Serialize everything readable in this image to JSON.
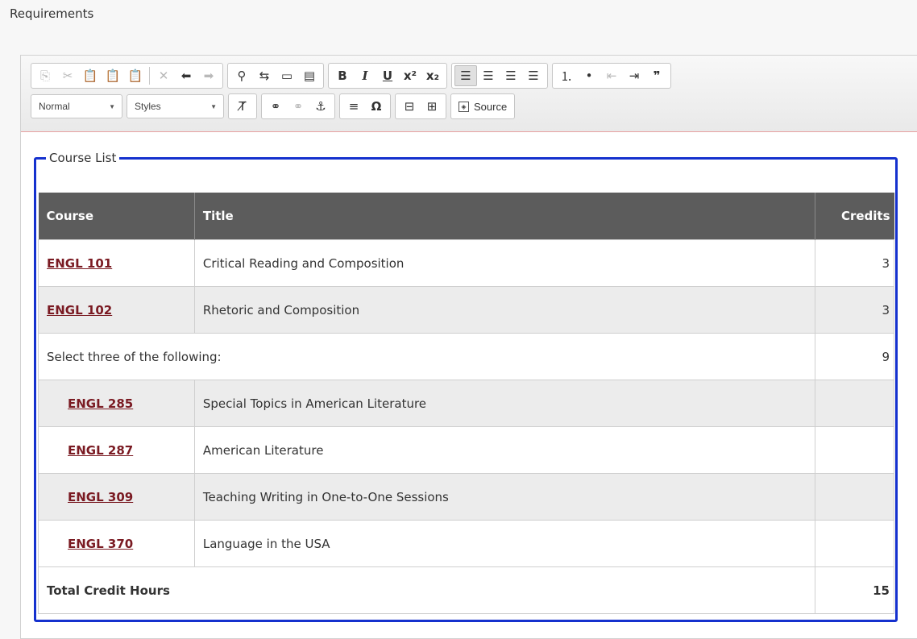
{
  "header": {
    "label": "Requirements"
  },
  "toolbar": {
    "format_value": "Normal",
    "styles_value": "Styles",
    "source_label": "Source"
  },
  "fieldset": {
    "legend": "Course List"
  },
  "table": {
    "headers": [
      "Course",
      "Title",
      "Credits"
    ],
    "rows": [
      {
        "code": "ENGL 101",
        "title": "Critical Reading and Composition",
        "credits": "3"
      },
      {
        "code": "ENGL 102",
        "title": "Rhetoric and Composition",
        "credits": "3"
      },
      {
        "note": "Select three of the following:",
        "credits": "9"
      },
      {
        "code": "ENGL 285",
        "title": "Special Topics in American Literature",
        "credits": ""
      },
      {
        "code": "ENGL 287",
        "title": "American Literature",
        "credits": ""
      },
      {
        "code": "ENGL 309",
        "title": "Teaching Writing in One-to-One Sessions",
        "credits": ""
      },
      {
        "code": "ENGL 370",
        "title": "Language in the USA",
        "credits": ""
      }
    ],
    "total_label": "Total Credit Hours",
    "total_credits": "15"
  }
}
